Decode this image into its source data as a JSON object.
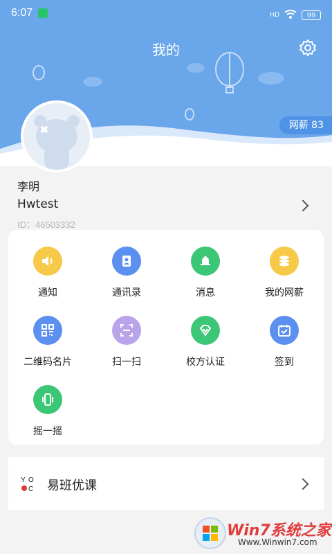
{
  "status": {
    "time": "6:07",
    "network": "HD",
    "battery": "99"
  },
  "header": {
    "title": "我的",
    "wallet_label": "网薪 83"
  },
  "profile": {
    "name": "李明",
    "school": "Hwtest",
    "id": "ID：46503332"
  },
  "grid": [
    {
      "label": "通知",
      "icon": "speaker-icon",
      "color": "#f7c948"
    },
    {
      "label": "通讯录",
      "icon": "contacts-icon",
      "color": "#5b8ff0"
    },
    {
      "label": "消息",
      "icon": "bell-icon",
      "color": "#3cc777"
    },
    {
      "label": "我的网薪",
      "icon": "coins-icon",
      "color": "#f7c948"
    },
    {
      "label": "二维码名片",
      "icon": "qr-code-icon",
      "color": "#5b8ff0"
    },
    {
      "label": "扫一扫",
      "icon": "scan-icon",
      "color": "#b9a4ea"
    },
    {
      "label": "校方认证",
      "icon": "diamond-icon",
      "color": "#3cc777"
    },
    {
      "label": "签到",
      "icon": "calendar-check-icon",
      "color": "#5b8ff0"
    },
    {
      "label": "摇一摇",
      "icon": "shake-phone-icon",
      "color": "#3cc777"
    }
  ],
  "course": {
    "label": "易班优课",
    "logo_text": "YO C"
  },
  "watermark": {
    "brand": "Win7系统之家",
    "url": "Www.Winwin7.com"
  }
}
